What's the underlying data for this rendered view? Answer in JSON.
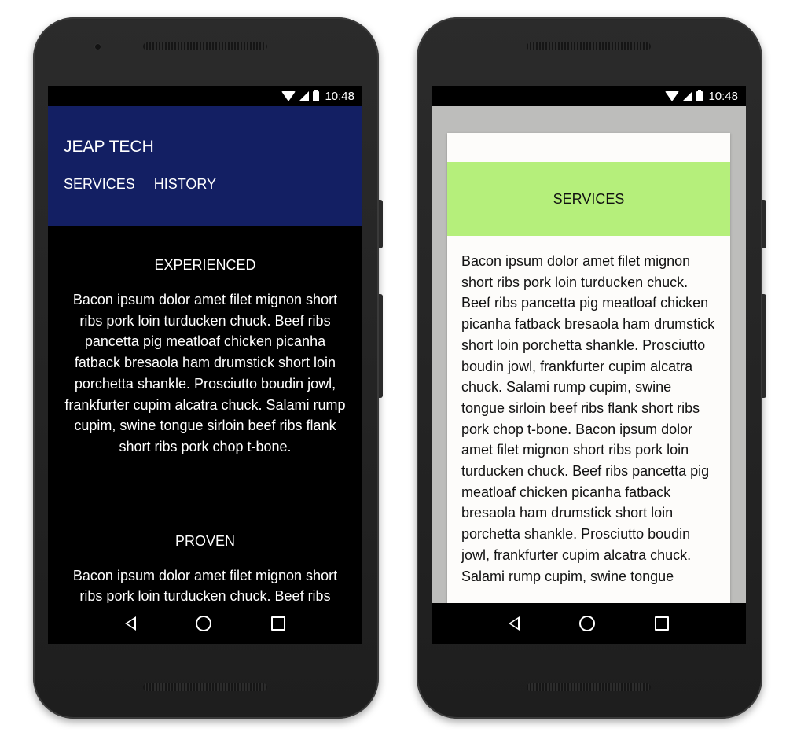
{
  "status": {
    "time": "10:48"
  },
  "left_phone": {
    "app_title": "JEAP TECH",
    "tabs": [
      "SERVICES",
      "HISTORY"
    ],
    "colors": {
      "header": "#131f63",
      "background": "#000000",
      "text": "#ffffff"
    },
    "sections": [
      {
        "heading": "EXPERIENCED",
        "body": "Bacon ipsum dolor amet filet mignon short ribs pork loin turducken chuck. Beef ribs pancetta pig meatloaf chicken picanha fatback bresaola ham drumstick short loin porchetta shankle. Prosciutto boudin jowl, frankfurter cupim alcatra chuck. Salami rump cupim, swine tongue sirloin beef ribs flank short ribs pork chop t-bone."
      },
      {
        "heading": "PROVEN",
        "body": "Bacon ipsum dolor amet filet mignon short ribs pork loin turducken chuck. Beef ribs"
      }
    ]
  },
  "right_phone": {
    "card_title": "SERVICES",
    "colors": {
      "band": "#b5ef7b",
      "card": "#fdfcfa",
      "backdrop": "#bdbdbb"
    },
    "card_body": "Bacon ipsum dolor amet filet mignon short ribs pork loin turducken chuck. Beef ribs pancetta pig meatloaf chicken picanha fatback bresaola ham drumstick short loin porchetta shankle. Prosciutto boudin jowl, frankfurter cupim alcatra chuck. Salami rump cupim, swine tongue sirloin beef ribs flank short ribs pork chop t-bone. Bacon ipsum dolor amet filet mignon short ribs pork loin turducken chuck. Beef ribs pancetta pig meatloaf chicken picanha fatback bresaola ham drumstick short loin porchetta shankle. Prosciutto boudin jowl, frankfurter cupim alcatra chuck. Salami rump cupim, swine tongue"
  },
  "icons": {
    "status": [
      "wifi-icon",
      "signal-icon",
      "battery-icon"
    ],
    "nav": [
      "back-icon",
      "home-icon",
      "recent-apps-icon"
    ]
  }
}
